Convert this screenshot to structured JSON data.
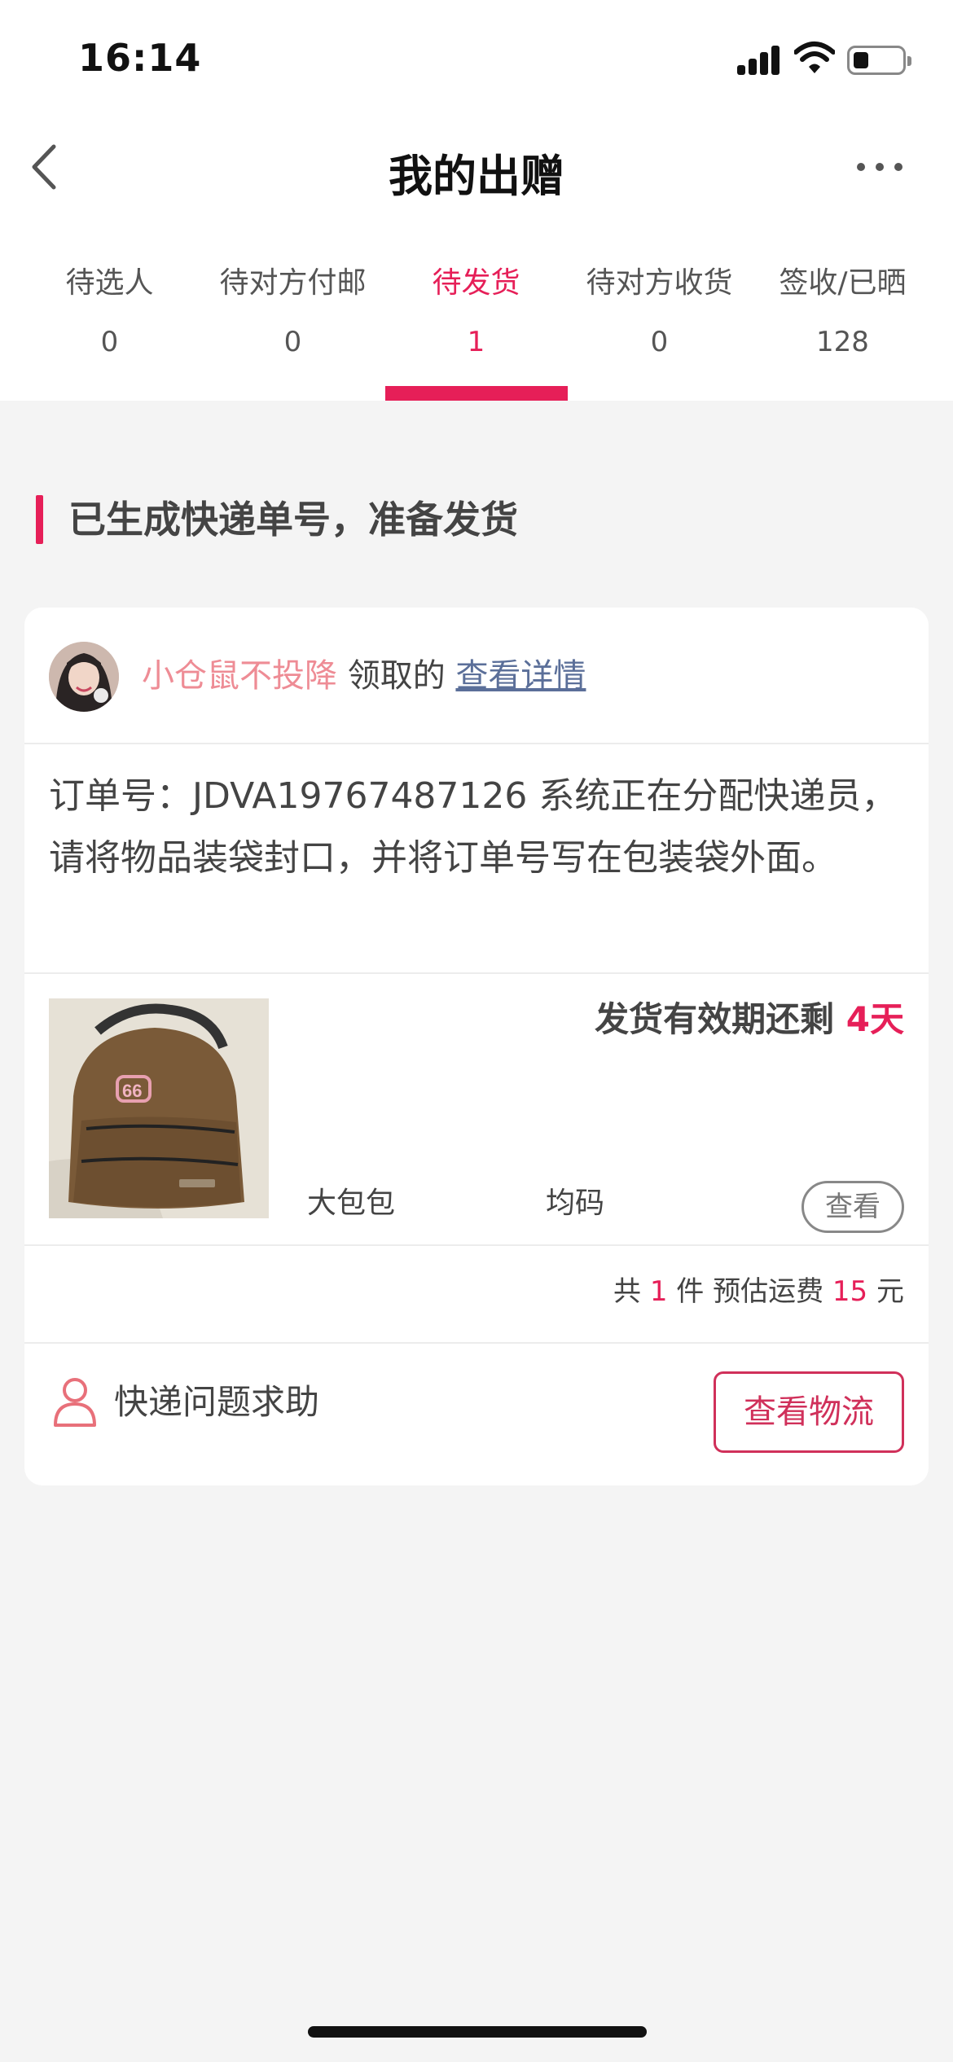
{
  "status_bar": {
    "time": "16:14"
  },
  "nav": {
    "title": "我的出赠"
  },
  "tabs": [
    {
      "label": "待选人",
      "count": "0"
    },
    {
      "label": "待对方付邮",
      "count": "0"
    },
    {
      "label": "待发货",
      "count": "1"
    },
    {
      "label": "待对方收货",
      "count": "0"
    },
    {
      "label": "签收/已晒",
      "count": "128"
    }
  ],
  "active_tab": "待发货",
  "section": {
    "title": "已生成快递单号，准备发货"
  },
  "card": {
    "user_name": "小仓鼠不投降",
    "claimed_text": "领取的",
    "detail_link": "查看详情",
    "order_text": "订单号：JDVA19767487126 系统正在分配快递员，请将物品装袋封口，并将订单号写在包装袋外面。",
    "deadline_label": "发货有效期还剩",
    "deadline_days": "4天",
    "item_name": "大包包",
    "item_size": "均码",
    "view_label": "查看",
    "summary": {
      "prefix": "共",
      "count": "1",
      "count_unit": "件 预估运费",
      "fee": "15",
      "fee_unit": "元"
    },
    "help_label": "快递问题求助",
    "logistics_label": "查看物流"
  },
  "colors": {
    "accent": "#e61f58",
    "user_name": "#ee8c95",
    "link": "#5b6f99",
    "background": "#f4f4f4"
  },
  "icons": [
    "back-chevron-icon",
    "more-dots-icon",
    "signal-icon",
    "wifi-icon",
    "battery-icon",
    "person-icon"
  ]
}
